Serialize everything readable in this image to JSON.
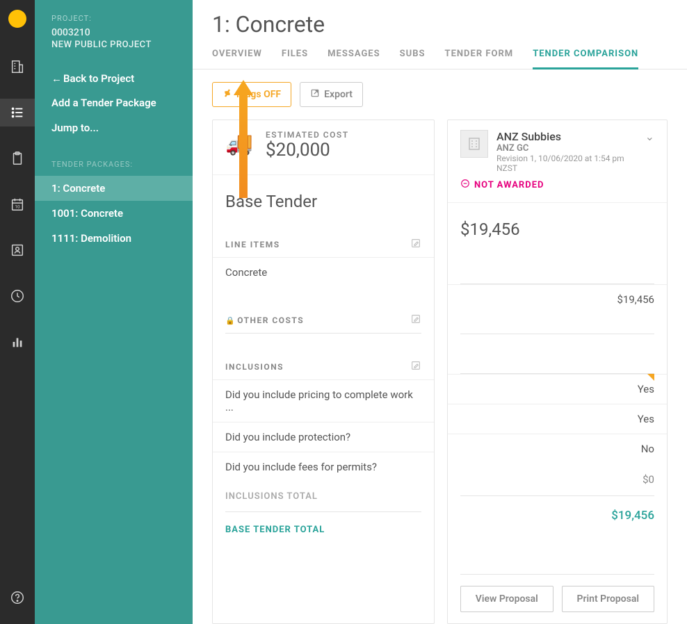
{
  "project": {
    "label": "PROJECT:",
    "number": "0003210",
    "name": "NEW PUBLIC PROJECT"
  },
  "sidebar": {
    "back": "Back to Project",
    "add": "Add a Tender Package",
    "jump": "Jump to...",
    "section_label": "TENDER PACKAGES:",
    "items": [
      {
        "label": "1: Concrete",
        "active": true
      },
      {
        "label": "1001: Concrete",
        "active": false
      },
      {
        "label": "1111: Demolition",
        "active": false
      }
    ]
  },
  "page": {
    "title": "1: Concrete"
  },
  "tabs": [
    {
      "label": "OVERVIEW"
    },
    {
      "label": "FILES"
    },
    {
      "label": "MESSAGES"
    },
    {
      "label": "SUBS"
    },
    {
      "label": "TENDER FORM"
    },
    {
      "label": "TENDER COMPARISON",
      "active": true
    }
  ],
  "toolbar": {
    "plugs": "Plugs OFF",
    "export": "Export"
  },
  "estimate": {
    "label": "ESTIMATED COST",
    "value": "$20,000"
  },
  "base_tender_label": "Base Tender",
  "line_items": {
    "label": "LINE ITEMS",
    "rows": [
      {
        "name": "Concrete",
        "value": "$19,456"
      }
    ]
  },
  "other_costs_label": "OTHER COSTS",
  "inclusions": {
    "label": "INCLUSIONS",
    "rows": [
      {
        "q": "Did you include pricing to complete work ...",
        "a": "Yes"
      },
      {
        "q": "Did you include protection?",
        "a": "Yes"
      },
      {
        "q": "Did you include fees for permits?",
        "a": "No"
      }
    ],
    "total_label": "INCLUSIONS TOTAL",
    "total_value": "$0"
  },
  "base_total": {
    "label": "BASE TENDER TOTAL",
    "value": "$19,456"
  },
  "sub": {
    "name": "ANZ Subbies",
    "company": "ANZ GC",
    "revision": "Revision 1, 10/06/2020 at 1:54 pm NZST",
    "status": "NOT AWARDED",
    "amount": "$19,456"
  },
  "actions": {
    "view": "View Proposal",
    "print": "Print Proposal"
  }
}
